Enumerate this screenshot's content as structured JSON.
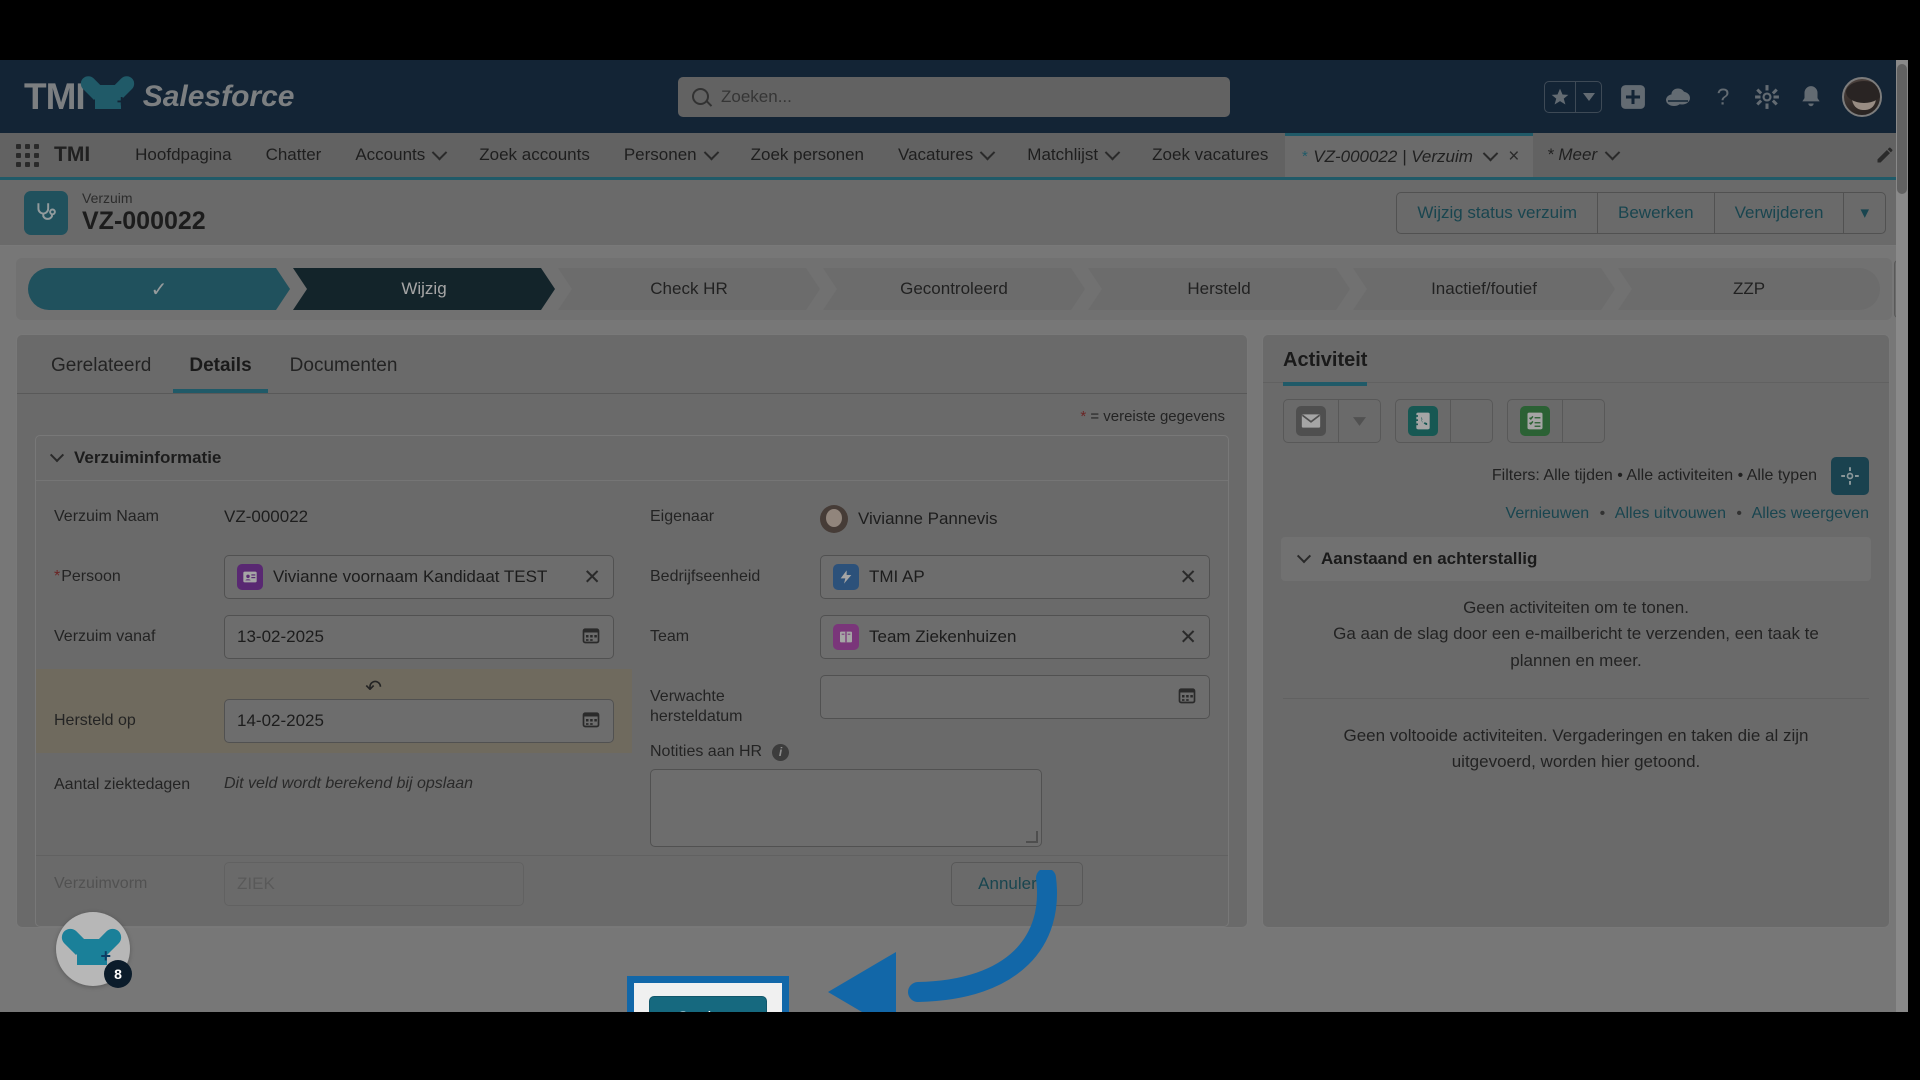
{
  "global_header": {
    "logo_tmi": "TMI",
    "logo_salesforce": "Salesforce",
    "search_placeholder": "Zoeken...",
    "icons": [
      "favorites-star-icon",
      "favorites-caret-icon",
      "global-add-icon",
      "cloud-setup-icon",
      "help-icon",
      "settings-gear-icon",
      "notifications-bell-icon",
      "user-avatar"
    ]
  },
  "nav": {
    "app_name": "TMI",
    "items": [
      {
        "label": "Hoofdpagina",
        "caret": false
      },
      {
        "label": "Chatter",
        "caret": false
      },
      {
        "label": "Accounts",
        "caret": true
      },
      {
        "label": "Zoek accounts",
        "caret": false
      },
      {
        "label": "Personen",
        "caret": true
      },
      {
        "label": "Zoek personen",
        "caret": false
      },
      {
        "label": "Vacatures",
        "caret": true
      },
      {
        "label": "Matchlijst",
        "caret": true
      },
      {
        "label": "Zoek vacatures",
        "caret": false
      }
    ],
    "active_tab": {
      "star": "*",
      "label": "VZ-000022 | Verzuim",
      "caret": "⌄",
      "close": "×"
    },
    "more_label": "* Meer"
  },
  "record_header": {
    "object_type": "Verzuim",
    "record_name": "VZ-000022",
    "actions": [
      "Wijzig status verzuim",
      "Bewerken",
      "Verwijderen"
    ],
    "overflow_caret": "▾"
  },
  "path": {
    "stages": [
      {
        "label": "",
        "state": "done",
        "check": "✓"
      },
      {
        "label": "Wijzig",
        "state": "current"
      },
      {
        "label": "Check HR",
        "state": "todo"
      },
      {
        "label": "Gecontroleerd",
        "state": "todo"
      },
      {
        "label": "Hersteld",
        "state": "todo"
      },
      {
        "label": "Inactief/foutief",
        "state": "todo"
      },
      {
        "label": "ZZP",
        "state": "todo"
      }
    ]
  },
  "left_panel": {
    "tabs": [
      {
        "label": "Gerelateerd",
        "active": false
      },
      {
        "label": "Details",
        "active": true
      },
      {
        "label": "Documenten",
        "active": false
      }
    ],
    "required_note": "= vereiste gegevens",
    "required_star": "*",
    "section_title": "Verzuiminformatie",
    "fields_left": [
      {
        "label": "Verzuim Naam",
        "value": "VZ-000022",
        "type": "static"
      },
      {
        "label": "Persoon",
        "value": "Vivianne voornaam Kandidaat TEST",
        "type": "lookup",
        "required": true,
        "icon": "contact-card-icon",
        "icon_color": "#7c28a8"
      },
      {
        "label": "Verzuim vanaf",
        "value": "13-02-2025",
        "type": "date"
      },
      {
        "label": "Hersteld op",
        "value": "14-02-2025",
        "type": "date",
        "highlighted": true,
        "undo": "↶"
      },
      {
        "label": "Aantal ziektedagen",
        "value": "Dit veld wordt berekend bij opslaan",
        "type": "note"
      }
    ],
    "fields_right": [
      {
        "label": "Eigenaar",
        "value": "Vivianne Pannevis",
        "type": "owner"
      },
      {
        "label": "Bedrijfseenheid",
        "value": "TMI AP",
        "type": "lookup",
        "icon": "lightning-bolt-icon",
        "icon_color": "#2f6fb5"
      },
      {
        "label": "Team",
        "value": "Team Ziekenhuizen",
        "type": "lookup",
        "icon": "book-icon",
        "icon_color": "#b640b6"
      },
      {
        "label": "Verwachte hersteldatum",
        "value": "",
        "type": "date"
      },
      {
        "label": "Notities aan HR",
        "value": "",
        "type": "textarea",
        "info": "i"
      }
    ],
    "footer": {
      "verzuimvorm_label": "Verzuimvorm",
      "verzuimvorm_value": "ZIEK",
      "cancel_label": "Annuleren",
      "save_label": "Opslaan"
    }
  },
  "right_panel": {
    "title": "Activiteit",
    "action_buttons": [
      {
        "name": "email-icon",
        "color": "#6b6b6b"
      },
      {
        "name": "log-a-call-icon",
        "color": "#0b7a73"
      },
      {
        "name": "new-task-icon",
        "color": "#2e8b3d"
      }
    ],
    "filters_text": "Filters: Alle tijden • Alle activiteiten • Alle typen",
    "gear_icon": "settings-gear-icon",
    "links": [
      "Vernieuwen",
      "Alles uitvouwen",
      "Alles weergeven"
    ],
    "link_separator": "•",
    "accordion_title": "Aanstaand en achterstallig",
    "empty_upcoming_line1": "Geen activiteiten om te tonen.",
    "empty_upcoming_line2": "Ga aan de slag door een e-mailbericht te verzenden, een taak te plannen en meer.",
    "empty_completed": "Geen voltooide activiteiten. Vergaderingen en taken die al zijn uitgevoerd, worden hier getoond."
  },
  "health_widget": {
    "badge_count": "8",
    "icon": "heart-plus-icon"
  },
  "annotation": {
    "highlight_color": "#1267a8",
    "arrow_color": "#1267a8",
    "target": "Opslaan"
  },
  "colors": {
    "header_bg": "#04213f",
    "accent_teal": "#1a7f96",
    "link_teal": "#0e5a6b",
    "path_current": "#04212c",
    "path_done": "#1a6e83",
    "highlight_row": "#a39a85"
  }
}
